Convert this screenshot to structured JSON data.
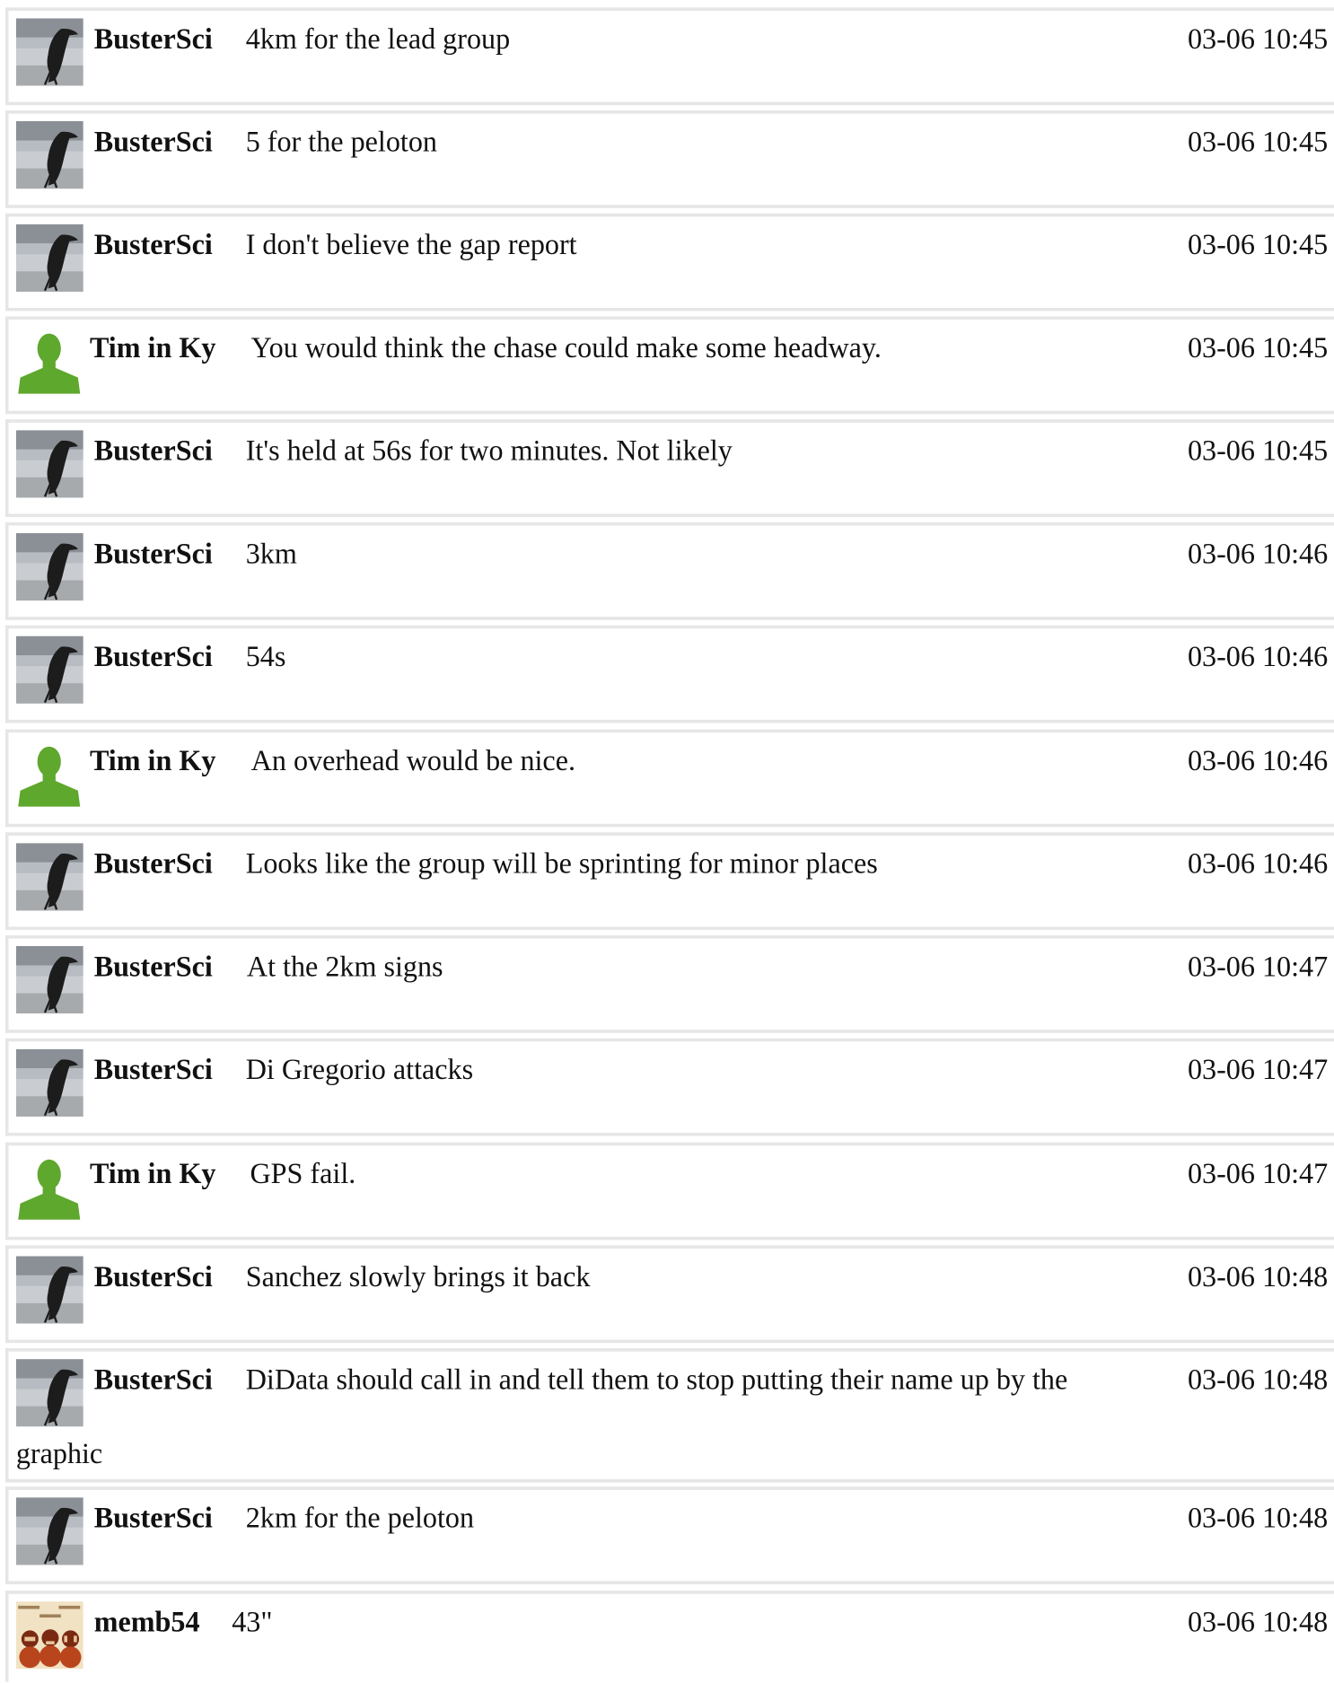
{
  "messages": [
    {
      "user": "BusterSci",
      "avatar": "penguin-avatar",
      "text": "4km for the lead group",
      "time": "03-06 10:45"
    },
    {
      "user": "BusterSci",
      "avatar": "penguin-avatar",
      "text": "5 for the peloton",
      "time": "03-06 10:45"
    },
    {
      "user": "BusterSci",
      "avatar": "penguin-avatar",
      "text": "I don't believe the gap report",
      "time": "03-06 10:45"
    },
    {
      "user": "Tim in Ky",
      "avatar": "default-user-avatar",
      "text": "You would think the chase could make some headway.",
      "time": "03-06 10:45"
    },
    {
      "user": "BusterSci",
      "avatar": "penguin-avatar",
      "text": "It's held at 56s for two minutes. Not likely",
      "time": "03-06 10:45"
    },
    {
      "user": "BusterSci",
      "avatar": "penguin-avatar",
      "text": "3km",
      "time": "03-06 10:46"
    },
    {
      "user": "BusterSci",
      "avatar": "penguin-avatar",
      "text": "54s",
      "time": "03-06 10:46"
    },
    {
      "user": "Tim in Ky",
      "avatar": "default-user-avatar",
      "text": "An overhead would be nice.",
      "time": "03-06 10:46"
    },
    {
      "user": "BusterSci",
      "avatar": "penguin-avatar",
      "text": "Looks like the group will be sprinting for minor places",
      "time": "03-06 10:46"
    },
    {
      "user": "BusterSci",
      "avatar": "penguin-avatar",
      "text": "At the 2km signs",
      "time": "03-06 10:47"
    },
    {
      "user": "BusterSci",
      "avatar": "penguin-avatar",
      "text": "Di Gregorio attacks",
      "time": "03-06 10:47"
    },
    {
      "user": "Tim in Ky",
      "avatar": "default-user-avatar",
      "text": "GPS fail.",
      "time": "03-06 10:47"
    },
    {
      "user": "BusterSci",
      "avatar": "penguin-avatar",
      "text": "Sanchez slowly brings it back",
      "time": "03-06 10:48"
    },
    {
      "user": "BusterSci",
      "avatar": "penguin-avatar",
      "text": "DiData should call in and tell them to stop putting their name up by the",
      "text_tail": "graphic",
      "time": "03-06 10:48"
    },
    {
      "user": "BusterSci",
      "avatar": "penguin-avatar",
      "text": "2km for the peloton",
      "time": "03-06 10:48"
    },
    {
      "user": "memb54",
      "avatar": "monkeys-avatar",
      "text": "43\"",
      "time": "03-06 10:48"
    }
  ]
}
